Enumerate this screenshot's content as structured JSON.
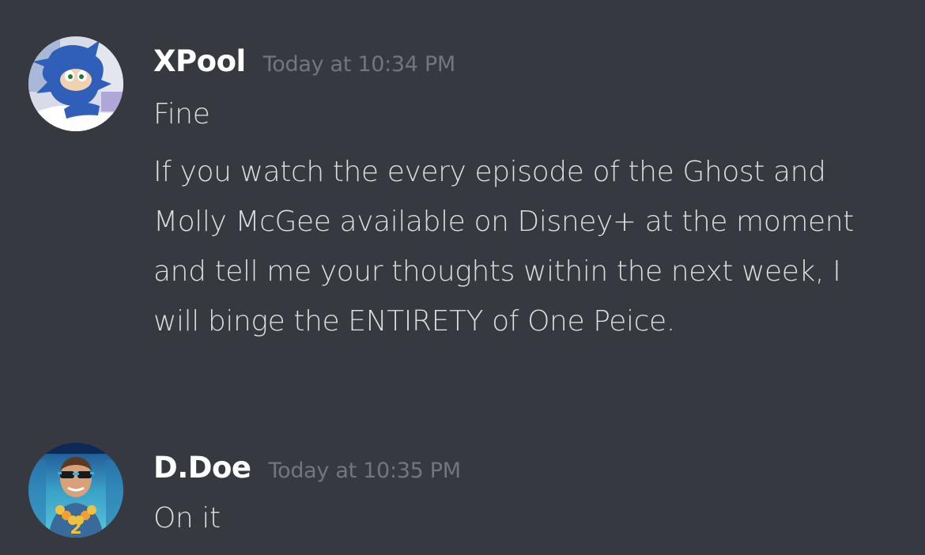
{
  "messages": [
    {
      "username": "XPool",
      "timestamp": "Today at 10:34 PM",
      "avatar_icon": "sonic-avatar",
      "lines": [
        "Fine",
        "If you watch the every episode of the Ghost and Molly McGee available on Disney+ at the moment and tell me your thoughts within the next week, I will binge the ENTIRETY of One Peice."
      ]
    },
    {
      "username": "D.Doe",
      "timestamp": "Today at 10:35 PM",
      "avatar_icon": "movie-poster-avatar",
      "lines": [
        "On it"
      ]
    }
  ],
  "colors": {
    "background": "#36393f",
    "username": "#ffffff",
    "timestamp": "#72767d",
    "text": "#dcddde"
  }
}
